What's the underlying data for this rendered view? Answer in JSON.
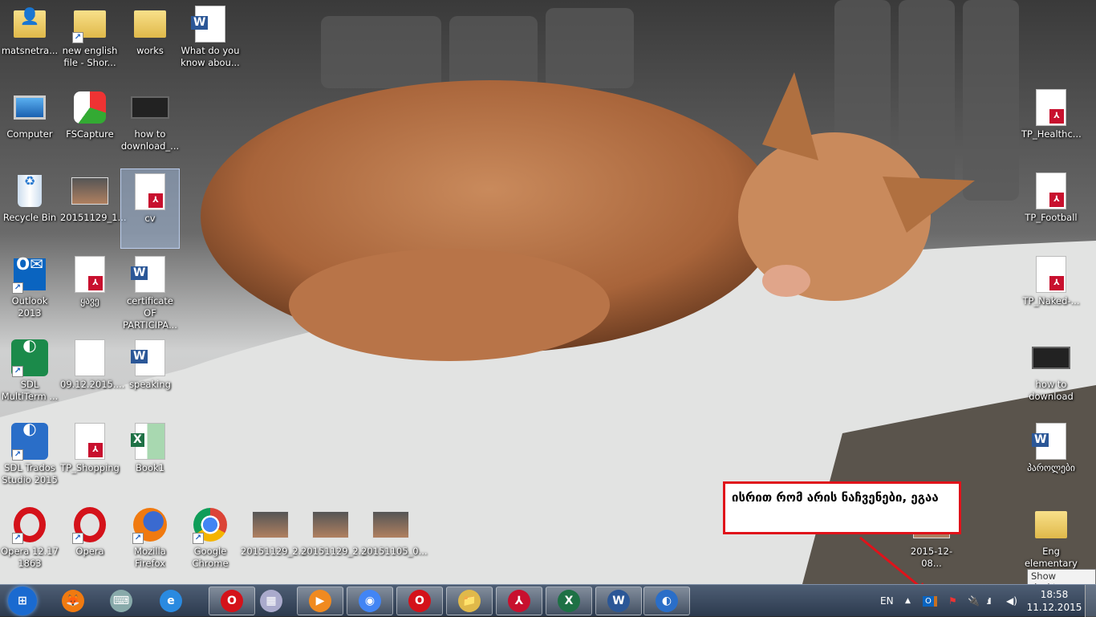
{
  "desktop_icons": [
    {
      "label": "matsnetra...",
      "type": "folder-user"
    },
    {
      "label": "new english file - Shor...",
      "type": "folder"
    },
    {
      "label": "works",
      "type": "folder"
    },
    {
      "label": "What do you know abou...",
      "type": "word"
    },
    {
      "label": "Computer",
      "type": "computer"
    },
    {
      "label": "FSCapture",
      "type": "fscapture"
    },
    {
      "label": "how to download_...",
      "type": "video"
    },
    {
      "label": "Recycle Bin",
      "type": "recycle"
    },
    {
      "label": "20151129_1...",
      "type": "photo"
    },
    {
      "label": "cv",
      "type": "pdf"
    },
    {
      "label": "Outlook 2013",
      "type": "outlook"
    },
    {
      "label": "ყავე",
      "type": "pdf"
    },
    {
      "label": "certificate OF PARTICIPA...",
      "type": "word"
    },
    {
      "label": "SDL MultiTerm ...",
      "type": "sdl-green"
    },
    {
      "label": "09.12.2015....",
      "type": "blank"
    },
    {
      "label": "speaking",
      "type": "word"
    },
    {
      "label": "SDL Trados Studio 2015",
      "type": "sdl-blue"
    },
    {
      "label": "TP_Shopping",
      "type": "pdf"
    },
    {
      "label": "Book1",
      "type": "excel"
    },
    {
      "label": "Opera 12.17 1863",
      "type": "opera"
    },
    {
      "label": "Opera",
      "type": "opera"
    },
    {
      "label": "Mozilla Firefox",
      "type": "firefox"
    },
    {
      "label": "Google Chrome",
      "type": "chrome"
    },
    {
      "label": "20151129_2...",
      "type": "photo"
    },
    {
      "label": "20151129_2...",
      "type": "photo"
    },
    {
      "label": "20151105_0...",
      "type": "photo"
    },
    {
      "label": "2015-12-08...",
      "type": "photo"
    }
  ],
  "right_icons": [
    {
      "label": "TP_Healthc...",
      "type": "pdf"
    },
    {
      "label": "TP_Football",
      "type": "pdf"
    },
    {
      "label": "TP_Naked-...",
      "type": "pdf"
    },
    {
      "label": "how to download",
      "type": "video"
    },
    {
      "label": "პაროლები",
      "type": "word"
    },
    {
      "label": "Eng elementary",
      "type": "folder"
    }
  ],
  "annotation": {
    "text": "ისრით რომ არის ნაჩვენები, ეგაა",
    "color": "#e0121a"
  },
  "taskbar": {
    "items": [
      "start",
      "firefox",
      "on-screen-keyboard",
      "internet-explorer",
      "opera",
      "calculator",
      "media-player",
      "chrome",
      "opera",
      "windows-explorer",
      "adobe-reader",
      "excel",
      "word",
      "sdl-trados"
    ],
    "language": "EN",
    "time": "18:58",
    "date": "11.12.2015",
    "tooltip": "Show desktop"
  }
}
